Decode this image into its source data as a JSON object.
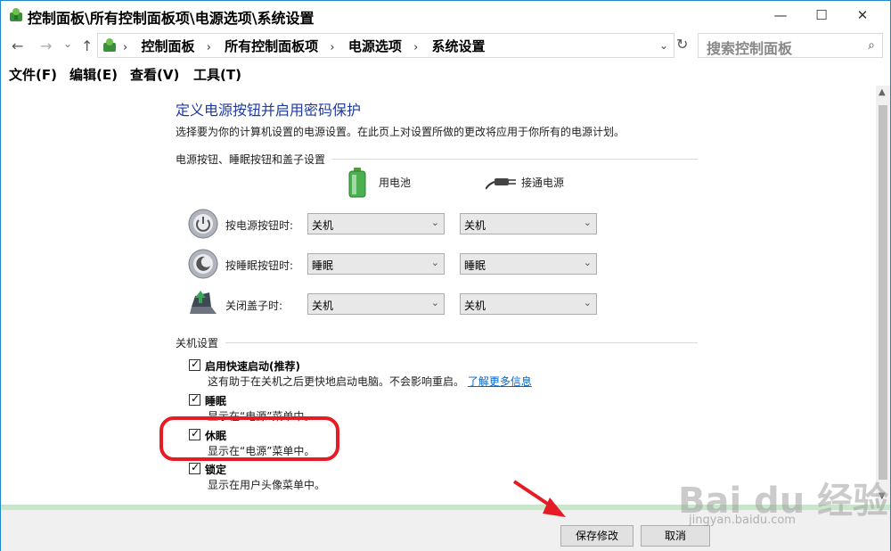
{
  "window": {
    "title": "控制面板\\所有控制面板项\\电源选项\\系统设置",
    "controls": {
      "minimize": "—",
      "maximize": "☐",
      "close": "✕"
    }
  },
  "nav": {
    "back": "←",
    "forward": "→",
    "up": "↑",
    "refresh": "↻",
    "dropdown": "⌄"
  },
  "breadcrumb": [
    "控制面板",
    "所有控制面板项",
    "电源选项",
    "系统设置"
  ],
  "breadcrumb_sep": "›",
  "search": {
    "placeholder": "搜索控制面板",
    "icon": "⌕"
  },
  "menu": [
    "文件(F)",
    "编辑(E)",
    "查看(V)",
    "工具(T)"
  ],
  "main": {
    "heading": "定义电源按钮并启用密码保护",
    "description": "选择要为你的计算机设置的电源设置。在此页上对设置所做的更改将应用于你所有的电源计划。",
    "buttons_group_label": "电源按钮、睡眠按钮和盖子设置",
    "col_battery": "用电池",
    "col_plugged": "接通电源",
    "rows": [
      {
        "label": "按电源按钮时:",
        "battery": "关机",
        "plugged": "关机"
      },
      {
        "label": "按睡眠按钮时:",
        "battery": "睡眠",
        "plugged": "睡眠"
      },
      {
        "label": "关闭盖子时:",
        "battery": "关机",
        "plugged": "关机"
      }
    ],
    "shutdown_group_label": "关机设置",
    "options": [
      {
        "label": "启用快速启动(推荐)",
        "desc": "这有助于在关机之后更快地启动电脑。不会影响重启。",
        "link": "了解更多信息",
        "checked": true
      },
      {
        "label": "睡眠",
        "desc": "显示在“电源”菜单中。",
        "checked": true
      },
      {
        "label": "休眠",
        "desc": "显示在“电源”菜单中。",
        "checked": true
      },
      {
        "label": "锁定",
        "desc": "显示在用户头像菜单中。",
        "checked": true
      }
    ],
    "check_glyph": "✓"
  },
  "footer": {
    "save": "保存修改",
    "cancel": "取消"
  },
  "watermark": {
    "main": "Bai du 经验",
    "sub": "jingyan.baidu.com"
  },
  "colors": {
    "heading": "#1f3aa0",
    "link": "#0066cc",
    "highlight": "#e51c23",
    "footer_band": "#c8e6c9"
  }
}
